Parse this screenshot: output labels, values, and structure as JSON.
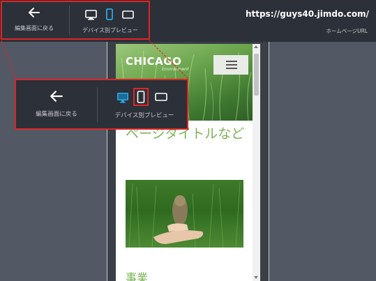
{
  "toolbar": {
    "back_label": "編集画面に戻る",
    "device_label": "デバイス別プレビュー",
    "site_url": "https://guys40.jimdo.com/",
    "homepage_url_label": "ホームページURL"
  },
  "zoom_callout": {
    "back_label": "編集画面に戻る",
    "device_label": "デバイス別プレビュー"
  },
  "preview": {
    "logo_text": "CHICAGO",
    "logo_sub": "Environment",
    "page_title": "ページタイトルなど",
    "section_heading": "事業"
  },
  "colors": {
    "highlight": "#e02424",
    "active_device": "#2aa8e6",
    "title_green": "#7cb356",
    "toolbar_bg": "#2c3038"
  },
  "icons": [
    "back-arrow-icon",
    "desktop-icon",
    "mobile-icon",
    "tablet-icon",
    "hamburger-menu-icon"
  ]
}
